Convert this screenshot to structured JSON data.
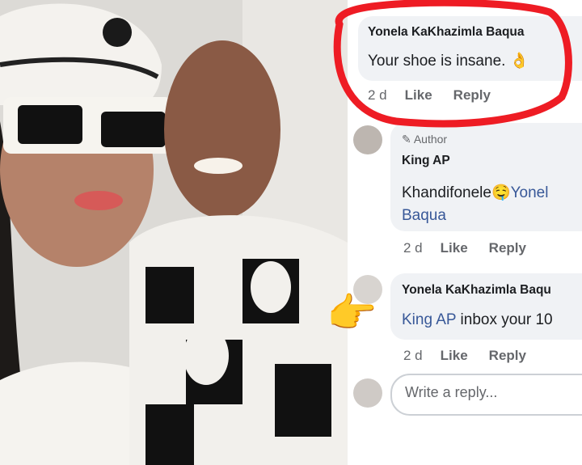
{
  "comments": [
    {
      "author": "Yonela KaKhazimla Baqua",
      "text": "Your shoe is insane. 👌",
      "time": "2 d",
      "like": "Like",
      "reply": "Reply"
    },
    {
      "author_badge": "✎ Author",
      "author": "King AP",
      "text_line1": "Khandifonele",
      "emoji": "🤤",
      "mention_part1": "Yonel",
      "mention_part2": "Baqua",
      "time": "2 d",
      "like": "Like",
      "reply": "Reply"
    },
    {
      "author": "Yonela KaKhazimla Baqu",
      "mention": "King AP",
      "text": " inbox your 10",
      "time": "2 d",
      "like": "Like",
      "reply": "Reply"
    }
  ],
  "reply_box": {
    "placeholder": "Write a reply..."
  },
  "colors": {
    "mention": "#385898",
    "highlight": "#ee1c24",
    "bubble": "#f0f2f5"
  },
  "annotations": {
    "pointer": "👉"
  }
}
